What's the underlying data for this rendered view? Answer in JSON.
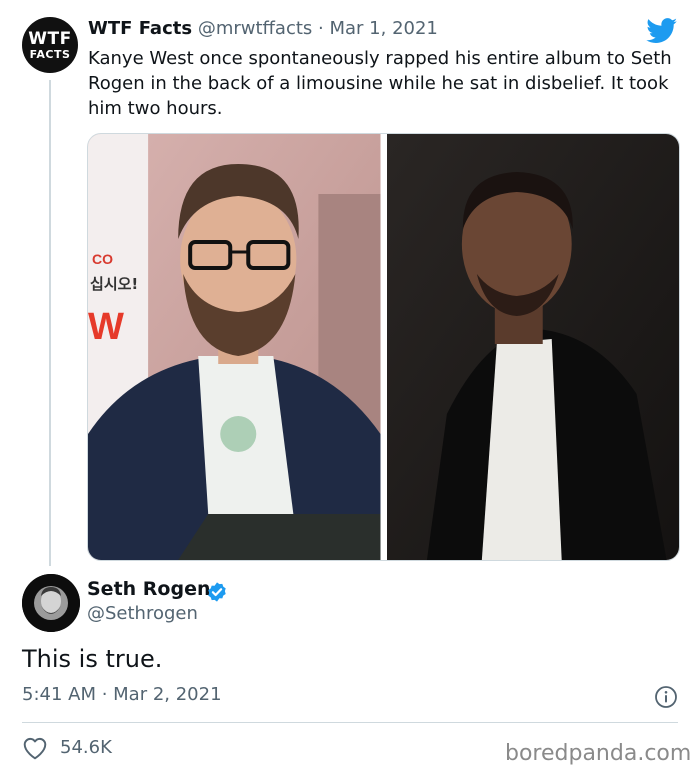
{
  "parent_tweet": {
    "avatar": {
      "line1": "WTF",
      "line2": "FACTS"
    },
    "author_name": "WTF Facts",
    "handle": "@mrwtffacts",
    "separator": "·",
    "date": "Mar 1, 2021",
    "text": "Kanye West once spontaneously rapped his entire album to Seth Rogen in the back of a limousine while he sat in disbelief. It took him two hours.",
    "platform_icon": "twitter-bird-icon",
    "media": [
      {
        "name": "photo-seth-rogen",
        "sign_text": [
          "CO",
          "십시오!",
          "W"
        ]
      },
      {
        "name": "photo-kanye-west"
      }
    ]
  },
  "reply": {
    "author_name": "Seth Rogen",
    "handle": "@Sethrogen",
    "text": "This is true.",
    "timestamp": "5:41 AM · Mar 2, 2021",
    "likes": "54.6K",
    "verified": true
  },
  "watermark": "boredpanda.com",
  "colors": {
    "twitter_blue": "#1d9bf0",
    "text_primary": "#0f1419",
    "text_secondary": "#536471",
    "divider": "#cfd9de"
  }
}
